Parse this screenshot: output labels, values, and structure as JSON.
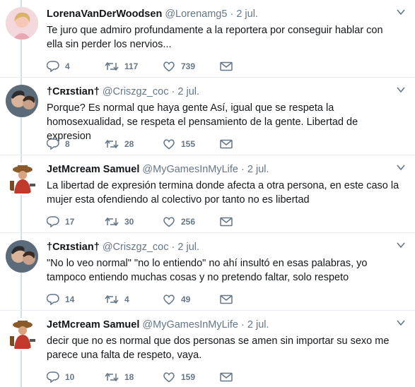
{
  "tweets": [
    {
      "name": "LorenaVanDerWoodsen",
      "handle": "@Lorenamg5",
      "separator": "·",
      "time": "2 jul.",
      "text": "Te juro que admiro profundamente a la reportera por conseguir hablar con ella sin perder los nervios...",
      "replies": "4",
      "retweets": "117",
      "likes": "739",
      "avatar": "avatar-lorena",
      "accent": "#e6a9b4"
    },
    {
      "name": "†Cʀɪstian†",
      "handle": "@Criszgz_coc",
      "separator": "·",
      "time": "2 jul.",
      "text": "Porque? Es normal que haya gente Así, igual que se respeta la homosexualidad, se respeta el pensamiento de la gente. Libertad de expresion",
      "replies": "8",
      "retweets": "28",
      "likes": "155",
      "avatar": "avatar-cristian",
      "accent": "#7f93a6"
    },
    {
      "name": "JetMcream Samuel",
      "handle": "@MyGamesInMyLife",
      "separator": "·",
      "time": "2 jul.",
      "text": "La libertad de expresión termina donde afecta a otra persona, en este caso la mujer esta ofendiendo al colectivo por tanto no es libertad",
      "replies": "17",
      "retweets": "30",
      "likes": "256",
      "avatar": "avatar-samuel",
      "accent": "#c0392b"
    },
    {
      "name": "†Cʀɪstian†",
      "handle": "@Criszgz_coc",
      "separator": "·",
      "time": "2 jul.",
      "text": "\"No lo veo normal\" \"no lo entiendo\" no ahí insultó en esas palabras, yo tampoco entiendo muchas cosas y no pretendo faltar, solo respeto",
      "replies": "14",
      "retweets": "4",
      "likes": "49",
      "avatar": "avatar-cristian",
      "accent": "#7f93a6"
    },
    {
      "name": "JetMcream Samuel",
      "handle": "@MyGamesInMyLife",
      "separator": "·",
      "time": "2 jul.",
      "text": "decir que no es normal que dos personas se amen sin importar su sexo me parece una falta de respeto, vaya.",
      "replies": "10",
      "retweets": "18",
      "likes": "159",
      "avatar": "avatar-samuel",
      "accent": "#c0392b"
    }
  ],
  "colors": {
    "muted": "#657786",
    "text": "#14171a",
    "divider": "#e6ecf0",
    "thread_line": "#d7dee3"
  }
}
